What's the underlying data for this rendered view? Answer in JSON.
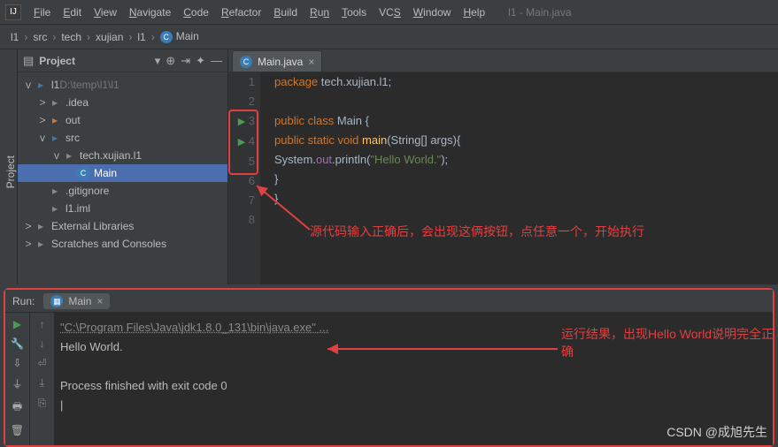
{
  "menu": {
    "items": [
      {
        "u": "F",
        "rest": "ile"
      },
      {
        "u": "E",
        "rest": "dit"
      },
      {
        "u": "V",
        "rest": "iew"
      },
      {
        "u": "N",
        "rest": "avigate"
      },
      {
        "u": "C",
        "rest": "ode"
      },
      {
        "u": "R",
        "rest": "efactor"
      },
      {
        "u": "B",
        "rest": "uild"
      },
      {
        "u": "R",
        "rest": "u",
        "tail": "n"
      },
      {
        "u": "T",
        "rest": "ools"
      },
      {
        "u": "",
        "rest": "VC",
        "tail": "S"
      },
      {
        "u": "W",
        "rest": "indow"
      },
      {
        "u": "H",
        "rest": "elp"
      }
    ],
    "title_extra": "l1 - Main.java"
  },
  "breadcrumb": {
    "parts": [
      "l1",
      "src",
      "tech",
      "xujian",
      "l1"
    ],
    "class_name": "Main"
  },
  "project_pane": {
    "title": "Project",
    "root": {
      "label": "l1",
      "hint": "D:\\temp\\l1\\l1"
    },
    "children": [
      {
        "label": ".idea",
        "indent": 1,
        "icon": "fld-g",
        "twist": ">"
      },
      {
        "label": "out",
        "indent": 1,
        "icon": "fld-o",
        "twist": ">"
      },
      {
        "label": "src",
        "indent": 1,
        "icon": "fld-b",
        "twist": "v"
      },
      {
        "label": "tech.xujian.l1",
        "indent": 2,
        "icon": "fld-g",
        "twist": "v"
      },
      {
        "label": "Main",
        "indent": 3,
        "icon": "cls",
        "selected": true
      },
      {
        "label": ".gitignore",
        "indent": 1,
        "icon": "fld-g"
      },
      {
        "label": "l1.iml",
        "indent": 1,
        "icon": "fld-g"
      }
    ],
    "ext": [
      {
        "label": "External Libraries"
      },
      {
        "label": "Scratches and Consoles"
      }
    ]
  },
  "editor": {
    "tab": {
      "label": "Main.java"
    },
    "lines": [
      {
        "n": "1",
        "html": "<span class='kw'>package</span> <span class='pkg'>tech.xujian.l1</span>;"
      },
      {
        "n": "2",
        "html": ""
      },
      {
        "n": "3",
        "run": true,
        "html": "<span class='kw'>public class</span> Main {"
      },
      {
        "n": "4",
        "run": true,
        "html": "    <span class='kw'>public static void</span> <span class='mth'>main</span>(String[] args){"
      },
      {
        "n": "5",
        "html": "        System.<span class='fld'>out</span>.println(<span class='str'>\"Hello World.\"</span>);"
      },
      {
        "n": "6",
        "html": "    }"
      },
      {
        "n": "7",
        "html": "}"
      },
      {
        "n": "8",
        "html": ""
      }
    ]
  },
  "run": {
    "title": "Run:",
    "tab": "Main",
    "cmd": "\"C:\\Program Files\\Java\\jdk1.8.0_131\\bin\\java.exe\" ...",
    "out": "Hello World.",
    "exit": "Process finished with exit code 0"
  },
  "annotations": {
    "a1": "源代码输入正确后，会出现这俩按钮，点任意一个，开始执行",
    "a2": "运行结果，出现Hello World说明完全正确"
  },
  "watermark": "CSDN @成旭先生",
  "sidebar_tab": "Project"
}
